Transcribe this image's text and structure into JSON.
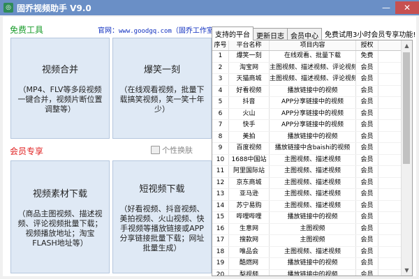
{
  "window": {
    "title": "固乔视频助手 V9.0",
    "icon": "app-logo-icon"
  },
  "left": {
    "free_title": "免费工具",
    "site_prefix": "官网：",
    "site_url": "www.goodgq.com",
    "site_suffix": "（固乔工作室）",
    "skin_label": "个性换肤",
    "vip_title": "会员专享",
    "tiles": [
      {
        "title": "视频合并",
        "desc": "（MP4、FLV等多段视频一键合并，视频片断位置调整等）"
      },
      {
        "title": "爆笑一刻",
        "desc": "（在线观看视频，批量下载搞笑视频，笑一笑十年少）"
      },
      {
        "title": "视频素材下载",
        "desc": "（商品主图视频、描述视频、评论视频批量下载；视频播放地址；淘宝FLASH地址等）"
      },
      {
        "title": "短视频下载",
        "desc": "（好看视频、抖音视频、美拍视频、火山视频、快手视频等播放链接或APP分享链接批量下载；网址批量生成）"
      }
    ]
  },
  "right": {
    "tabs": [
      "支持的平台",
      "更新日志",
      "会员中心"
    ],
    "promo": "免费试用3小时会员专享功能!",
    "columns": [
      "序号",
      "平台名称",
      "项目内容",
      "授权"
    ],
    "rows": [
      [
        "1",
        "爆笑一刻",
        "在线观看、批量下载",
        "免费"
      ],
      [
        "2",
        "淘宝网",
        "主图视频、描述视频、评论视频",
        "会员"
      ],
      [
        "3",
        "天猫商城",
        "主图视频、描述视频、评论视频",
        "会员"
      ],
      [
        "4",
        "好看视频",
        "播放链接中的视频",
        "会员"
      ],
      [
        "5",
        "抖音",
        "APP分享链接中的视频",
        "会员"
      ],
      [
        "6",
        "火山",
        "APP分享链接中的视频",
        "会员"
      ],
      [
        "7",
        "快手",
        "APP分享链接中的视频",
        "会员"
      ],
      [
        "8",
        "美拍",
        "播放链接中的视频",
        "会员"
      ],
      [
        "9",
        "百度视频",
        "播放链接中含baishi的视频",
        "会员"
      ],
      [
        "10",
        "1688中国站",
        "主图视频、描述视频",
        "会员"
      ],
      [
        "11",
        "阿里国际站",
        "主图视频、描述视频",
        "会员"
      ],
      [
        "12",
        "京东商城",
        "主图视频、描述视频",
        "会员"
      ],
      [
        "13",
        "亚马逊",
        "主图视频、描述视频",
        "会员"
      ],
      [
        "14",
        "苏宁易购",
        "主图视频、描述视频",
        "会员"
      ],
      [
        "15",
        "哔哩哔哩",
        "播放链接中的视频",
        "会员"
      ],
      [
        "16",
        "生意网",
        "主图视频",
        "会员"
      ],
      [
        "17",
        "搜款网",
        "主图视频",
        "会员"
      ],
      [
        "18",
        "唯品会",
        "主图视频、描述视频",
        "会员"
      ],
      [
        "19",
        "酷燃网",
        "播放链接中的视频",
        "会员"
      ],
      [
        "20",
        "梨视频",
        "播放链接中的视频",
        "会员"
      ]
    ]
  }
}
